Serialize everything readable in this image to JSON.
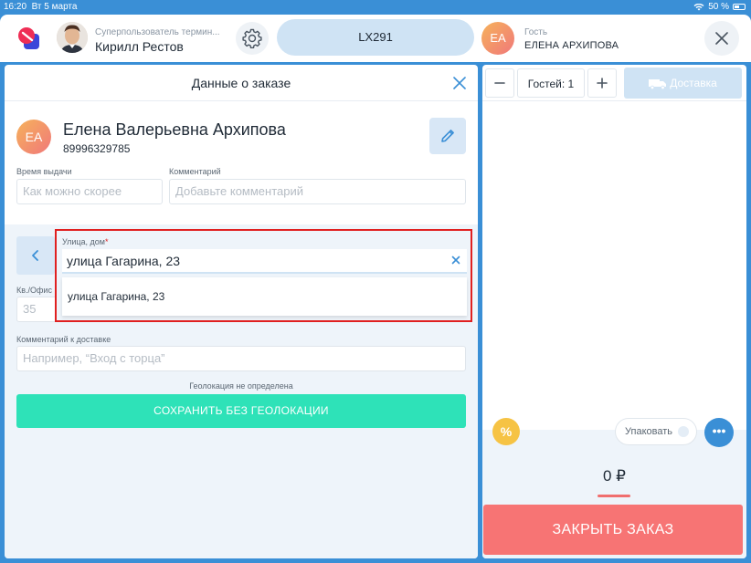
{
  "status_bar": {
    "time": "16:20",
    "date": "Вт 5 марта",
    "battery": "50 %",
    "battery_level": 0.5
  },
  "header": {
    "user_role": "Суперпользователь термин...",
    "user_name": "Кирилл Рестов",
    "table_code": "LX291",
    "guest_initials": "ЕА",
    "guest_label": "Гость",
    "guest_name": "ЕЛЕНА АРХИПОВА"
  },
  "order_panel": {
    "title": "Данные о заказе",
    "customer": {
      "initials": "ЕА",
      "full_name": "Елена Валерьевна Архипова",
      "phone": "89996329785"
    },
    "pickup_time": {
      "label": "Время выдачи",
      "placeholder": "Как можно скорее"
    },
    "comment": {
      "label": "Комментарий",
      "placeholder": "Добавьте комментарий"
    },
    "street": {
      "label": "Улица, дом",
      "required_mark": "*",
      "value": "улица Гагарина, 23"
    },
    "suggestions": [
      "улица Гагарина, 23"
    ],
    "apartment": {
      "label": "Кв./Офис",
      "value": "35"
    },
    "delivery_comment": {
      "label": "Комментарий к доставке",
      "placeholder": "Например, “Вход с торца”"
    },
    "geo_status": "Геолокация не определена",
    "save_button": "СОХРАНИТЬ БЕЗ ГЕОЛОКАЦИИ"
  },
  "right_panel": {
    "guests_label": "Гостей: 1",
    "delivery_button": "Доставка",
    "discount_symbol": "%",
    "pack_label": "Упаковать",
    "more_symbol": "•••",
    "total": "0 ₽",
    "close_order_button": "ЗАКРЫТЬ ЗАКАЗ"
  },
  "colors": {
    "brand_blue": "#3a8fd6",
    "save_green": "#2ee2b8",
    "close_red": "#f77474",
    "highlight_red": "#e02020",
    "discount_yellow": "#f6c344"
  }
}
